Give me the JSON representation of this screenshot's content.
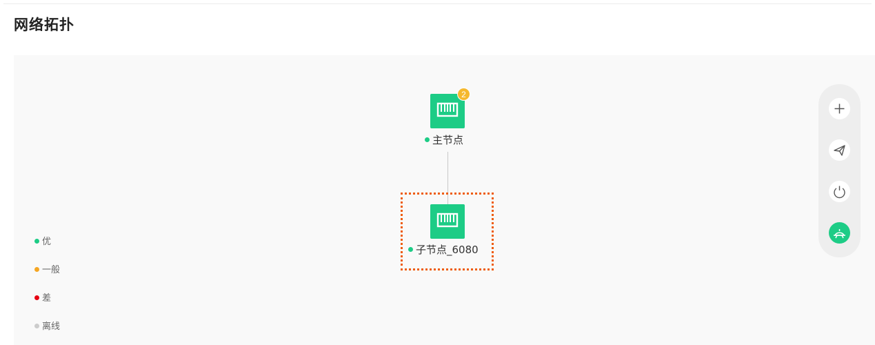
{
  "page": {
    "title": "网络拓扑"
  },
  "topology": {
    "main_node": {
      "label": "主节点",
      "badge": "2",
      "status_color": "#1dcc86"
    },
    "sub_node": {
      "label": "子节点_6080",
      "status_color": "#1dcc86"
    }
  },
  "legend": [
    {
      "label": "优",
      "color": "#1dcc86"
    },
    {
      "label": "一般",
      "color": "#f5a623"
    },
    {
      "label": "差",
      "color": "#e60012"
    },
    {
      "label": "离线",
      "color": "#cccccc"
    }
  ],
  "toolbar": {
    "buttons": [
      {
        "icon": "plus-icon"
      },
      {
        "icon": "send-icon"
      },
      {
        "icon": "power-icon"
      },
      {
        "icon": "topology-view-icon",
        "active": true
      }
    ]
  },
  "colors": {
    "accent": "#1dcc86",
    "highlight": "#ee5c0c",
    "badge": "#f5b82e"
  }
}
